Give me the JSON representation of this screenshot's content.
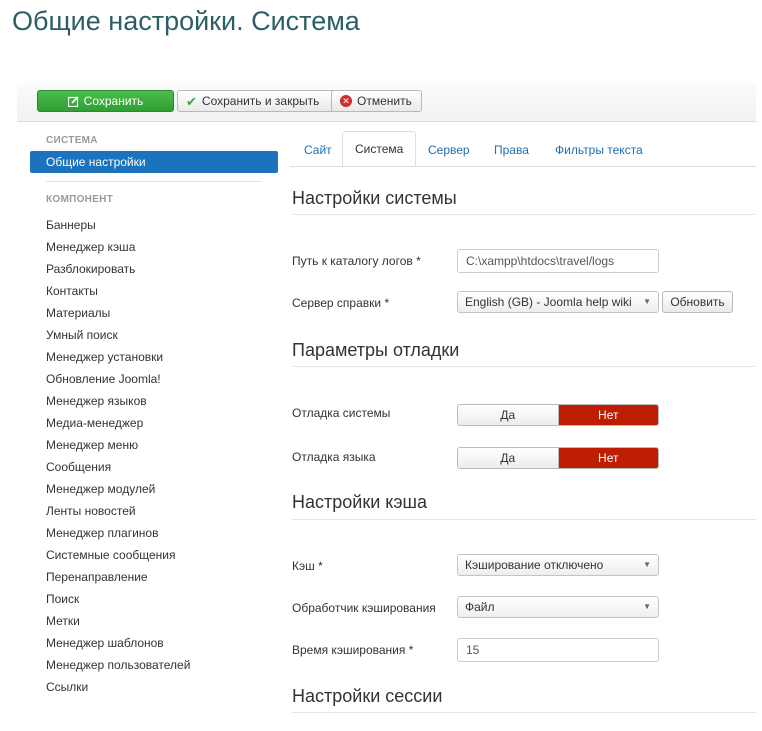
{
  "page": {
    "title": "Общие настройки. Система"
  },
  "toolbar": {
    "save_label": "Сохранить",
    "save_close_label": "Сохранить и закрыть",
    "cancel_label": "Отменить",
    "cancel_glyph": "✕"
  },
  "sidebar": {
    "system_header": "СИСТЕМА",
    "active_item": "Общие настройки",
    "component_header": "КОМПОНЕНТ",
    "items": [
      "Баннеры",
      "Менеджер кэша",
      "Разблокировать",
      "Контакты",
      "Материалы",
      "Умный поиск",
      "Менеджер установки",
      "Обновление Joomla!",
      "Менеджер языков",
      "Медиа-менеджер",
      "Менеджер меню",
      "Сообщения",
      "Менеджер модулей",
      "Ленты новостей",
      "Менеджер плагинов",
      "Системные сообщения",
      "Перенаправление",
      "Поиск",
      "Метки",
      "Менеджер шаблонов",
      "Менеджер пользователей",
      "Ссылки"
    ]
  },
  "tabs": [
    {
      "label": "Сайт",
      "active": false
    },
    {
      "label": "Система",
      "active": true
    },
    {
      "label": "Сервер",
      "active": false
    },
    {
      "label": "Права",
      "active": false
    },
    {
      "label": "Фильтры текста",
      "active": false
    }
  ],
  "system_settings": {
    "title": "Настройки системы",
    "log_path_label": "Путь к каталогу логов *",
    "log_path_value": "C:\\xampp\\htdocs\\travel/logs",
    "help_server_label": "Сервер справки *",
    "help_server_value": "English (GB) - Joomla help wiki",
    "refresh_label": "Обновить"
  },
  "debug_settings": {
    "title": "Параметры отладки",
    "system_debug_label": "Отладка системы",
    "language_debug_label": "Отладка языка",
    "yes_label": "Да",
    "no_label": "Нет",
    "system_debug_value": "Нет",
    "language_debug_value": "Нет"
  },
  "cache_settings": {
    "title": "Настройки кэша",
    "cache_label": "Кэш *",
    "cache_value": "Кэширование отключено",
    "handler_label": "Обработчик кэширования",
    "handler_value": "Файл",
    "time_label": "Время кэширования *",
    "time_value": "15"
  },
  "session_settings": {
    "title": "Настройки сессии"
  },
  "colors": {
    "title": "#2b5f63",
    "save_green": "#3aa542",
    "active_blue": "#1a73bc",
    "toggle_red": "#bd1d00",
    "link": "#1f6fb2"
  }
}
